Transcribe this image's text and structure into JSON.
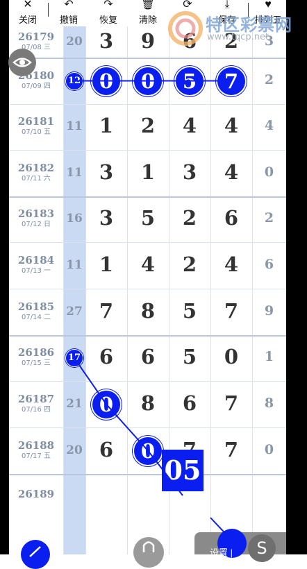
{
  "toolbar": {
    "close": "关闭",
    "undo": "撤销",
    "redo": "恢复",
    "clear": "清除",
    "share": "分享",
    "save": "保存",
    "extra": "排列五"
  },
  "watermark": {
    "name": "特区彩票网",
    "url": "www.tqcp.net"
  },
  "rows": [
    {
      "issue": "26179",
      "date": "07/08 三",
      "sum": "20",
      "d": [
        "3",
        "9",
        "6",
        "2"
      ],
      "span": "3"
    },
    {
      "issue": "26180",
      "date": "07/09 四",
      "sum": "12",
      "d": [
        "0",
        "0",
        "5",
        "7"
      ],
      "span": "2"
    },
    {
      "issue": "26181",
      "date": "07/10 五",
      "sum": "11",
      "d": [
        "1",
        "2",
        "4",
        "4"
      ],
      "span": "4"
    },
    {
      "issue": "26182",
      "date": "07/11 六",
      "sum": "11",
      "d": [
        "3",
        "1",
        "3",
        "4"
      ],
      "span": "0"
    },
    {
      "issue": "26183",
      "date": "07/12 日",
      "sum": "16",
      "d": [
        "3",
        "5",
        "2",
        "6"
      ],
      "span": "2"
    },
    {
      "issue": "26184",
      "date": "07/13 一",
      "sum": "11",
      "d": [
        "1",
        "4",
        "2",
        "4"
      ],
      "span": "6"
    },
    {
      "issue": "26185",
      "date": "07/14 二",
      "sum": "27",
      "d": [
        "7",
        "8",
        "5",
        "7"
      ],
      "span": "9"
    },
    {
      "issue": "26186",
      "date": "07/15 三",
      "sum": "17",
      "d": [
        "6",
        "6",
        "5",
        "0"
      ],
      "span": "1"
    },
    {
      "issue": "26187",
      "date": "07/16 四",
      "sum": "21",
      "d": [
        "0",
        "8",
        "6",
        "7"
      ],
      "span": "8"
    },
    {
      "issue": "26188",
      "date": "07/17 五",
      "sum": "20",
      "d": [
        "6",
        "0",
        "7",
        "7"
      ],
      "span": "0"
    },
    {
      "issue": "26189",
      "date": "",
      "sum": "",
      "d": [
        "",
        "",
        "",
        ""
      ],
      "span": ""
    }
  ],
  "prediction": "05",
  "bottom": {
    "settings": "设置 |"
  }
}
